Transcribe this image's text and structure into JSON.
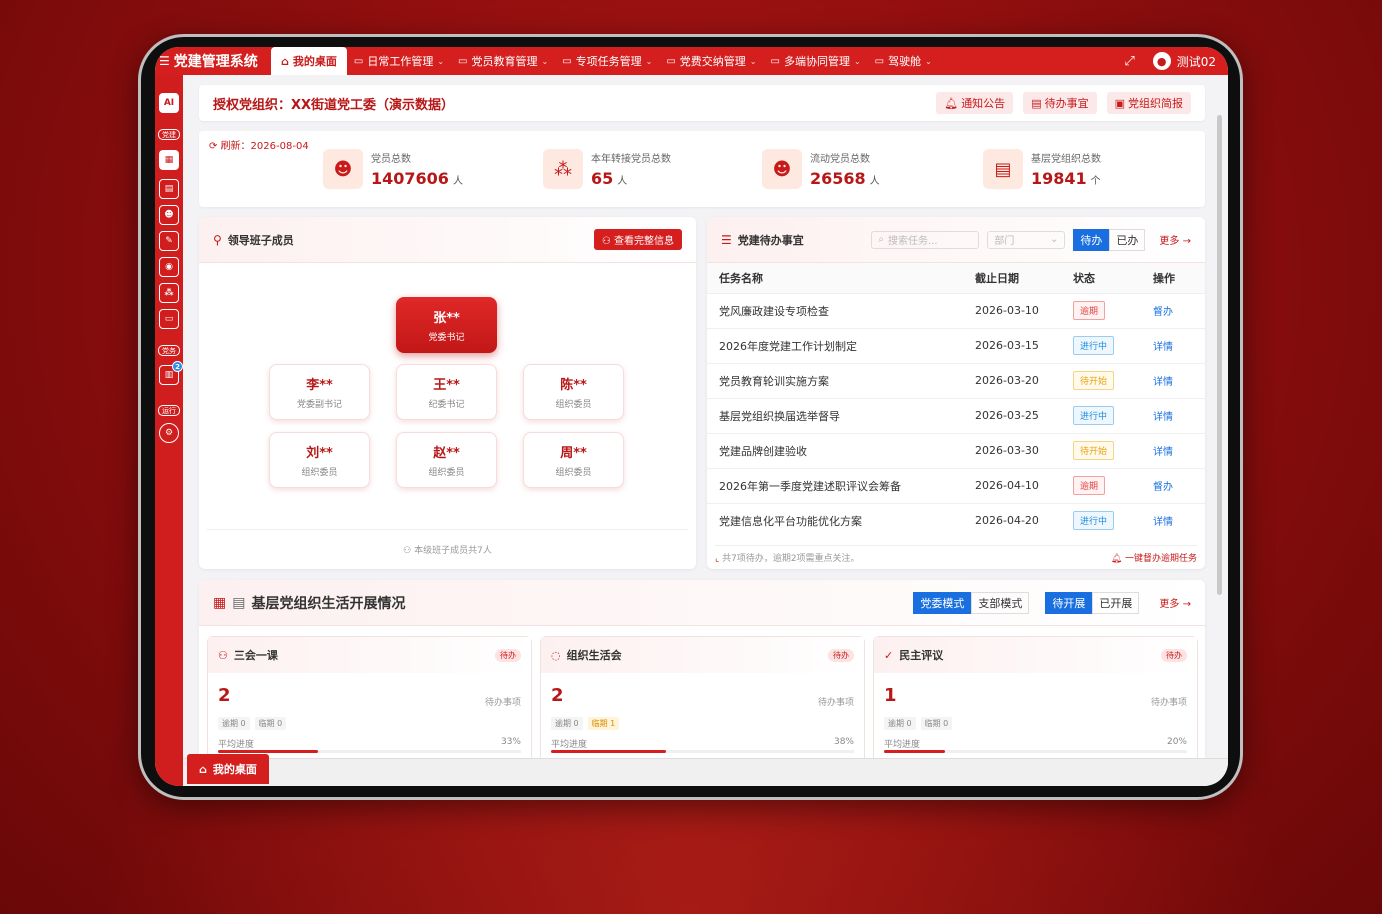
{
  "app": {
    "title": "党建管理系统",
    "user": "测试02"
  },
  "nav": {
    "home": "我的桌面",
    "items": [
      "日常工作管理",
      "党员教育管理",
      "专项任务管理",
      "党费交纳管理",
      "多端协同管理",
      "驾驶舱"
    ]
  },
  "sidebar": {
    "ai": "AI",
    "tag1": "党建",
    "tag2": "党务",
    "tag3": "运行",
    "badge": "2"
  },
  "org": {
    "title": "授权党组织：XX街道党工委（演示数据）",
    "btn_notice": "通知公告",
    "btn_todo": "待办事宜",
    "btn_brief": "党组织简报"
  },
  "stats": {
    "refresh": "刷新：2026-08-04",
    "items": [
      {
        "label": "党员总数",
        "value": "1407606",
        "unit": "人"
      },
      {
        "label": "本年转接党员总数",
        "value": "65",
        "unit": "人"
      },
      {
        "label": "流动党员总数",
        "value": "26568",
        "unit": "人"
      },
      {
        "label": "基层党组织总数",
        "value": "19841",
        "unit": "个"
      }
    ]
  },
  "leaders": {
    "title": "领导班子成员",
    "btn": "查看完整信息",
    "secretary": {
      "name": "张**",
      "role": "党委书记"
    },
    "members": [
      {
        "name": "李**",
        "role": "党委副书记"
      },
      {
        "name": "王**",
        "role": "纪委书记"
      },
      {
        "name": "陈**",
        "role": "组织委员"
      },
      {
        "name": "刘**",
        "role": "组织委员"
      },
      {
        "name": "赵**",
        "role": "组织委员"
      },
      {
        "name": "周**",
        "role": "组织委员"
      }
    ],
    "footer": "本级班子成员共7人"
  },
  "tasks": {
    "title": "党建待办事宜",
    "search_placeholder": "搜索任务...",
    "dept_placeholder": "部门",
    "tab_todo": "待办",
    "tab_done": "已办",
    "more": "更多",
    "headers": [
      "任务名称",
      "截止日期",
      "状态",
      "操作"
    ],
    "rows": [
      {
        "name": "党风廉政建设专项检查",
        "date": "2026-03-10",
        "status": "逾期",
        "kind": "over",
        "op": "督办"
      },
      {
        "name": "2026年度党建工作计划制定",
        "date": "2026-03-15",
        "status": "进行中",
        "kind": "ing",
        "op": "详情"
      },
      {
        "name": "党员教育轮训实施方案",
        "date": "2026-03-20",
        "status": "待开始",
        "kind": "wait",
        "op": "详情"
      },
      {
        "name": "基层党组织换届选举督导",
        "date": "2026-03-25",
        "status": "进行中",
        "kind": "ing",
        "op": "详情"
      },
      {
        "name": "党建品牌创建验收",
        "date": "2026-03-30",
        "status": "待开始",
        "kind": "wait",
        "op": "详情"
      },
      {
        "name": "2026年第一季度党建述职评议会筹备",
        "date": "2026-04-10",
        "status": "逾期",
        "kind": "over",
        "op": "督办"
      },
      {
        "name": "党建信息化平台功能优化方案",
        "date": "2026-04-20",
        "status": "进行中",
        "kind": "ing",
        "op": "详情"
      }
    ],
    "footer_left": "共7项待办，逾期2项需重点关注。",
    "footer_right": "一键督办逾期任务"
  },
  "life": {
    "title": "基层党组织生活开展情况",
    "mode_a": "党委模式",
    "mode_b": "支部模式",
    "state_a": "待开展",
    "state_b": "已开展",
    "more": "更多",
    "cards": [
      {
        "title": "三会一课",
        "pill": "待办",
        "count": "2",
        "pending": "待办事项",
        "overdue": "逾期 0",
        "near": "临期 0",
        "near_warn": false,
        "progress_label": "平均进度",
        "progress": "33%",
        "pct": 33
      },
      {
        "title": "组织生活会",
        "pill": "待办",
        "count": "2",
        "pending": "待办事项",
        "overdue": "逾期 0",
        "near": "临期 1",
        "near_warn": true,
        "progress_label": "平均进度",
        "progress": "38%",
        "pct": 38
      },
      {
        "title": "民主评议",
        "pill": "待办",
        "count": "1",
        "pending": "待办事项",
        "overdue": "逾期 0",
        "near": "临期 0",
        "near_warn": false,
        "progress_label": "平均进度",
        "progress": "20%",
        "pct": 20
      }
    ]
  },
  "bottom_tab": "我的桌面"
}
